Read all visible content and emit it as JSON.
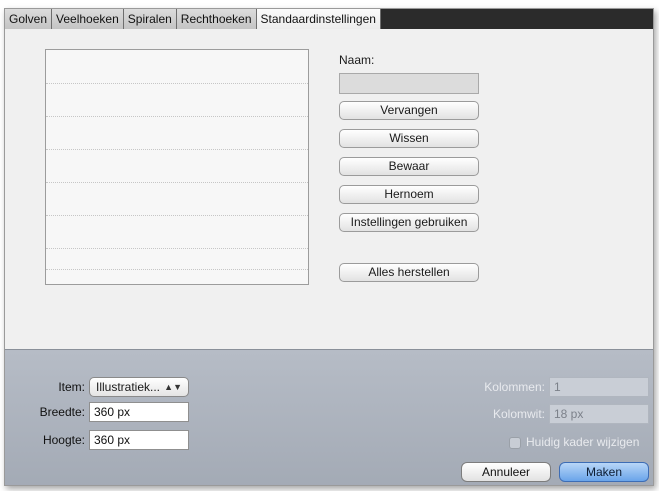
{
  "tabs": [
    {
      "label": "Golven",
      "active": false
    },
    {
      "label": "Veelhoeken",
      "active": false
    },
    {
      "label": "Spiralen",
      "active": false
    },
    {
      "label": "Rechthoeken",
      "active": false
    },
    {
      "label": "Standaardinstellingen",
      "active": true
    }
  ],
  "presets": {
    "name_label": "Naam:",
    "name_value": "",
    "buttons": {
      "replace": "Vervangen",
      "delete": "Wissen",
      "save": "Bewaar",
      "rename": "Hernoem",
      "use_settings": "Instellingen gebruiken",
      "restore_all": "Alles herstellen"
    }
  },
  "bottom": {
    "item_label": "Item:",
    "item_value": "Illustratiek...",
    "width_label": "Breedte:",
    "width_value": "360 px",
    "height_label": "Hoogte:",
    "height_value": "360 px",
    "columns_label": "Kolommen:",
    "columns_value": "1",
    "column_width_label": "Kolomwit:",
    "column_width_value": "18 px",
    "modify_frame_label": "Huidig kader wijzigen",
    "modify_frame_checked": false,
    "cancel_label": "Annuleer",
    "ok_label": "Maken"
  },
  "colors": {
    "tab_bar": "#2b2b2b",
    "panel": "#f0f0f0",
    "bottom_panel": "#aeb4be",
    "default_button": "#6aa4ea"
  }
}
